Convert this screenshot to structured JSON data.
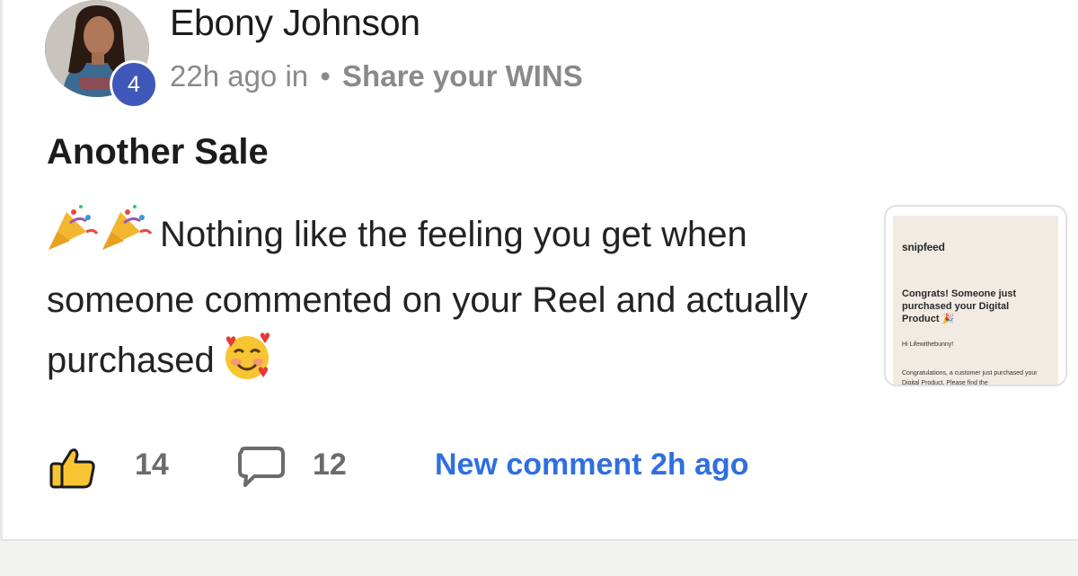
{
  "post": {
    "author": "Ebony Johnson",
    "level": "4",
    "time": "22h ago in",
    "separator": "•",
    "space": "Share your WINS",
    "title": "Another Sale",
    "body": "Nothing like the feeling you get when someone commented on your Reel and actually purchased",
    "leading_emoji": "party-popper-icon",
    "trailing_emoji": "smiling-face-with-hearts-icon"
  },
  "attachment": {
    "brand": "snipfeed",
    "heading": "Congrats! Someone just purchased your Digital Product 🎉",
    "greeting": "Hi Lifewithebunny!",
    "text": "Congratulations, a customer just purchased your Digital Product. Please find the"
  },
  "actions": {
    "likes": "14",
    "comments": "12",
    "new_comment": "New comment 2h ago"
  },
  "colors": {
    "badge": "#3f57b8",
    "link": "#2f6fe0",
    "muted": "#8a8a8a",
    "thumb_bg": "#f1ebe4"
  }
}
